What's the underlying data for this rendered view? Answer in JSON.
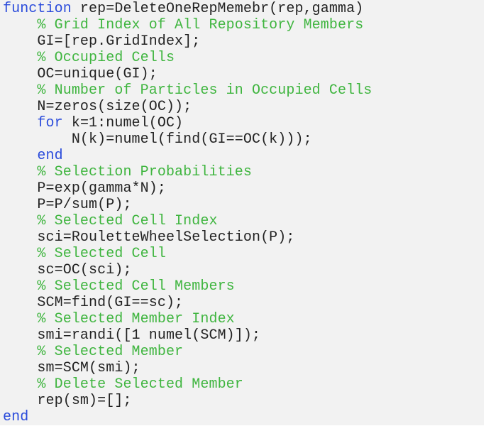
{
  "editor": {
    "language": "MATLAB",
    "colors": {
      "background": "#f2f2f2",
      "keyword": "#2a4bdb",
      "comment": "#3fb53f",
      "code": "#222222"
    },
    "lines": [
      {
        "indent": "",
        "tokens": [
          {
            "type": "keyword",
            "text": "function"
          },
          {
            "type": "code",
            "text": " rep=DeleteOneRepMemebr(rep,gamma)"
          }
        ]
      },
      {
        "indent": "    ",
        "tokens": [
          {
            "type": "comment",
            "text": "% Grid Index of All Repository Members"
          }
        ]
      },
      {
        "indent": "    ",
        "tokens": [
          {
            "type": "code",
            "text": "GI=[rep.GridIndex];"
          }
        ]
      },
      {
        "indent": "    ",
        "tokens": [
          {
            "type": "comment",
            "text": "% Occupied Cells"
          }
        ]
      },
      {
        "indent": "    ",
        "tokens": [
          {
            "type": "code",
            "text": "OC=unique(GI);"
          }
        ]
      },
      {
        "indent": "    ",
        "tokens": [
          {
            "type": "comment",
            "text": "% Number of Particles in Occupied Cells"
          }
        ]
      },
      {
        "indent": "    ",
        "tokens": [
          {
            "type": "code",
            "text": "N=zeros(size(OC));"
          }
        ]
      },
      {
        "indent": "    ",
        "tokens": [
          {
            "type": "keyword",
            "text": "for"
          },
          {
            "type": "code",
            "text": " k=1:numel(OC)"
          }
        ]
      },
      {
        "indent": "        ",
        "tokens": [
          {
            "type": "code",
            "text": "N(k)=numel(find(GI==OC(k)));"
          }
        ]
      },
      {
        "indent": "    ",
        "tokens": [
          {
            "type": "keyword",
            "text": "end"
          }
        ]
      },
      {
        "indent": "    ",
        "tokens": [
          {
            "type": "comment",
            "text": "% Selection Probabilities"
          }
        ]
      },
      {
        "indent": "    ",
        "tokens": [
          {
            "type": "code",
            "text": "P=exp(gamma*N);"
          }
        ]
      },
      {
        "indent": "    ",
        "tokens": [
          {
            "type": "code",
            "text": "P=P/sum(P);"
          }
        ]
      },
      {
        "indent": "    ",
        "tokens": [
          {
            "type": "comment",
            "text": "% Selected Cell Index"
          }
        ]
      },
      {
        "indent": "    ",
        "tokens": [
          {
            "type": "code",
            "text": "sci=RouletteWheelSelection(P);"
          }
        ]
      },
      {
        "indent": "    ",
        "tokens": [
          {
            "type": "comment",
            "text": "% Selected Cell"
          }
        ]
      },
      {
        "indent": "    ",
        "tokens": [
          {
            "type": "code",
            "text": "sc=OC(sci);"
          }
        ]
      },
      {
        "indent": "    ",
        "tokens": [
          {
            "type": "comment",
            "text": "% Selected Cell Members"
          }
        ]
      },
      {
        "indent": "    ",
        "tokens": [
          {
            "type": "code",
            "text": "SCM=find(GI==sc);"
          }
        ]
      },
      {
        "indent": "    ",
        "tokens": [
          {
            "type": "comment",
            "text": "% Selected Member Index"
          }
        ]
      },
      {
        "indent": "    ",
        "tokens": [
          {
            "type": "code",
            "text": "smi=randi([1 numel(SCM)]);"
          }
        ]
      },
      {
        "indent": "    ",
        "tokens": [
          {
            "type": "comment",
            "text": "% Selected Member"
          }
        ]
      },
      {
        "indent": "    ",
        "tokens": [
          {
            "type": "code",
            "text": "sm=SCM(smi);"
          }
        ]
      },
      {
        "indent": "    ",
        "tokens": [
          {
            "type": "comment",
            "text": "% Delete Selected Member"
          }
        ]
      },
      {
        "indent": "    ",
        "tokens": [
          {
            "type": "code",
            "text": "rep(sm)=[];"
          }
        ]
      },
      {
        "indent": "",
        "tokens": [
          {
            "type": "keyword",
            "text": "end"
          }
        ]
      }
    ]
  }
}
